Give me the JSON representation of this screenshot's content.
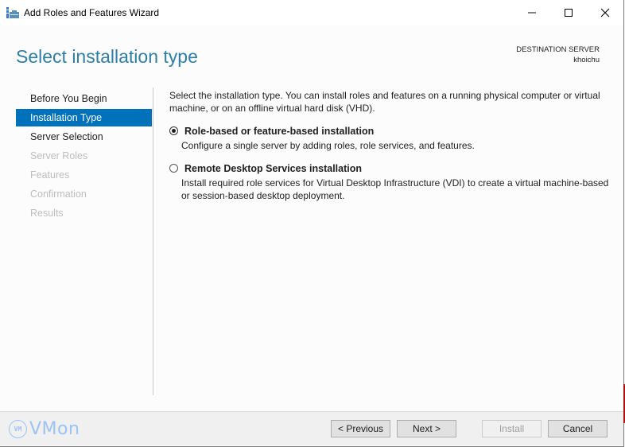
{
  "window": {
    "title": "Add Roles and Features Wizard",
    "controls": [
      "minimize",
      "maximize",
      "close"
    ]
  },
  "header": {
    "page_title": "Select installation type",
    "destination_label": "DESTINATION SERVER",
    "destination_server": "khoichu"
  },
  "nav": {
    "items": [
      {
        "label": "Before You Begin",
        "state": "enabled"
      },
      {
        "label": "Installation Type",
        "state": "active"
      },
      {
        "label": "Server Selection",
        "state": "enabled"
      },
      {
        "label": "Server Roles",
        "state": "disabled"
      },
      {
        "label": "Features",
        "state": "disabled"
      },
      {
        "label": "Confirmation",
        "state": "disabled"
      },
      {
        "label": "Results",
        "state": "disabled"
      }
    ]
  },
  "content": {
    "intro": "Select the installation type. You can install roles and features on a running physical computer or virtual machine, or on an offline virtual hard disk (VHD).",
    "options": [
      {
        "title": "Role-based or feature-based installation",
        "description": "Configure a single server by adding roles, role services, and features.",
        "selected": true
      },
      {
        "title": "Remote Desktop Services installation",
        "description": "Install required role services for Virtual Desktop Infrastructure (VDI) to create a virtual machine-based or session-based desktop deployment.",
        "selected": false
      }
    ]
  },
  "footer": {
    "watermark_badge": "VM",
    "watermark_text": "VMon",
    "buttons": {
      "previous": "< Previous",
      "next": "Next >",
      "install": "Install",
      "cancel": "Cancel"
    }
  },
  "colors": {
    "accent": "#0071bb",
    "title": "#2e7fa6",
    "disabled_text": "#bdbdbd",
    "watermark": "#9cc3f5"
  }
}
